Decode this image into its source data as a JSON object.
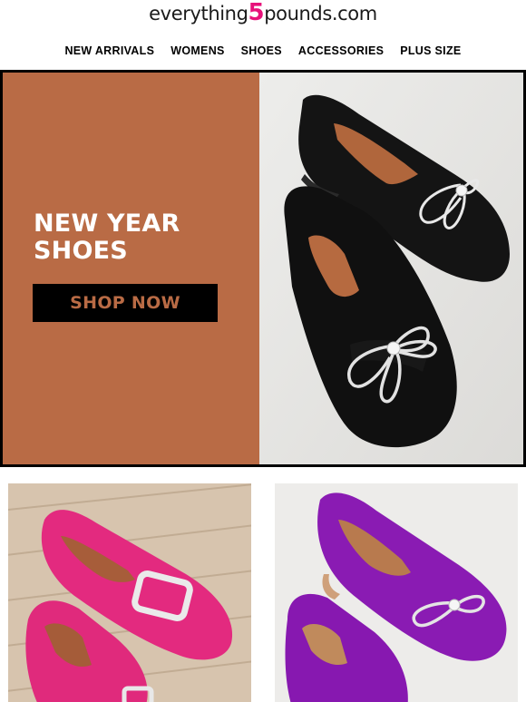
{
  "brand": {
    "name_prefix": "everything",
    "name_number": "5",
    "name_suffix": "pounds.com",
    "accent": "#e7127a"
  },
  "nav": {
    "items": [
      "NEW ARRIVALS",
      "WOMENS",
      "SHOES",
      "ACCESSORIES",
      "PLUS SIZE"
    ]
  },
  "hero": {
    "title_line1": "NEW YEAR",
    "title_line2": "SHOES",
    "cta_label": "SHOP NOW",
    "panel_color": "#b96b45",
    "image": "black-suede-loafers-with-crystal-bow"
  },
  "products": [
    {
      "image": "pink-loafers-with-crystal-buckle",
      "color": "#e32a7f"
    },
    {
      "image": "purple-suede-loafers-with-crystal-bow",
      "color": "#8a1bb3"
    }
  ]
}
